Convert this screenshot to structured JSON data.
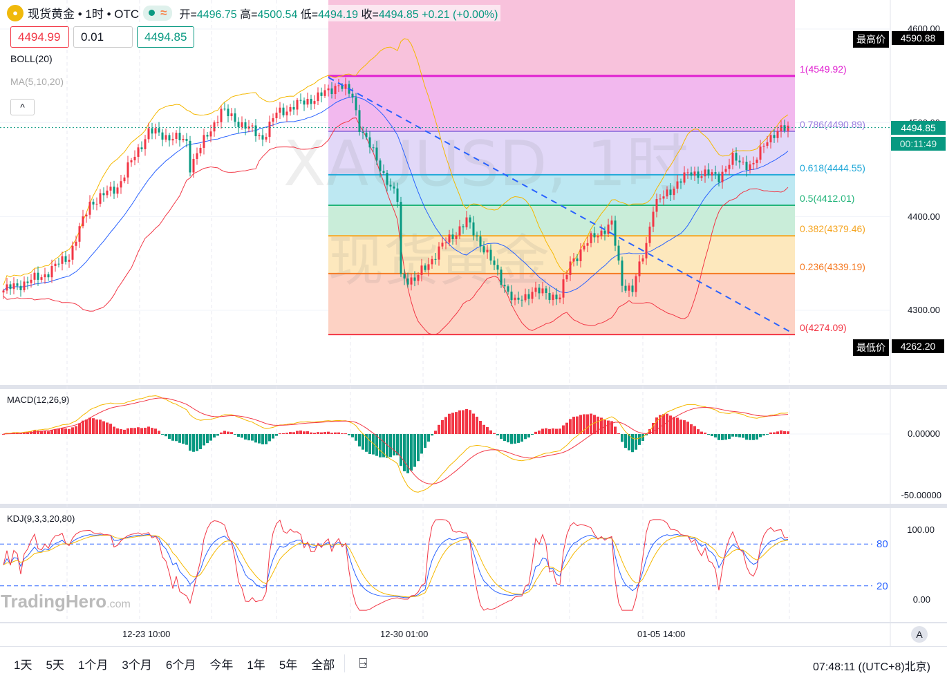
{
  "header": {
    "symbol": "现货黄金 • 1时 • OTC",
    "open_label": "开=",
    "open": "4496.75",
    "high_label": "高=",
    "high": "4500.54",
    "low_label": "低=",
    "low": "4494.19",
    "close_label": "收=",
    "close": "4494.85",
    "change": "+0.21 (+0.00%)"
  },
  "order": {
    "sell": "4494.99",
    "spread": "0.01",
    "buy": "4494.85"
  },
  "indicators": {
    "boll": "BOLL(20)",
    "ma": "MA(5,10,20)",
    "collapse": "^"
  },
  "price_axis": {
    "ticks": [
      "4600.00",
      "4500.00",
      "4400.00",
      "4300.00"
    ],
    "highest_label": "最高价",
    "highest": "4590.88",
    "lowest_label": "最低价",
    "lowest": "4262.20",
    "last": "4494.85",
    "countdown": "00:11:49"
  },
  "watermark": {
    "line1": "XAUUSD, 1时",
    "line2": "现货黄金",
    "brand": "TradingHero",
    "brand_suffix": ".com"
  },
  "fib": {
    "levels": [
      {
        "ratio": "1",
        "price": 4549.92,
        "color": "#e020d0"
      },
      {
        "ratio": "0.786",
        "price": 4490.89,
        "color": "#9c7fe0"
      },
      {
        "ratio": "0.618",
        "price": 4444.55,
        "color": "#21a8d8"
      },
      {
        "ratio": "0.5",
        "price": 4412.01,
        "color": "#22b47a"
      },
      {
        "ratio": "0.382",
        "price": 4379.46,
        "color": "#f5a623"
      },
      {
        "ratio": "0.236",
        "price": 4339.19,
        "color": "#f57a23"
      },
      {
        "ratio": "0",
        "price": 4274.09,
        "color": "#f23645"
      }
    ],
    "labels": [
      "1(4549.92)",
      "0.786(4490.89)",
      "0.618(4444.55)",
      "0.5(4412.01)",
      "0.382(4379.46)",
      "0.236(4339.19)",
      "0(4274.09)"
    ]
  },
  "macd": {
    "label": "MACD(12,26,9)",
    "ticks": [
      "0.00000",
      "-50.00000"
    ]
  },
  "kdj": {
    "label": "KDJ(9,3,3,20,80)",
    "ticks": [
      "100.00",
      "0.00"
    ],
    "levels": [
      "80",
      "20"
    ]
  },
  "time_axis": [
    "12-23 10:00",
    "12-30 01:00",
    "01-05 14:00"
  ],
  "auto_label": "A",
  "ranges": [
    "1天",
    "5天",
    "1个月",
    "3个月",
    "6个月",
    "今年",
    "1年",
    "5年",
    "全部"
  ],
  "clock": "07:48:11 ((UTC+8)北京)",
  "colors": {
    "up": "#f23645",
    "down": "#089981",
    "boll_upper": "#f5b800",
    "boll_mid": "#2962ff",
    "boll_lower": "#f23645"
  },
  "chart_data": {
    "type": "candlestick",
    "symbol": "XAUUSD",
    "interval": "1h",
    "ylim": [
      4262,
      4600
    ],
    "waypoints": [
      [
        0,
        4321
      ],
      [
        11,
        4336
      ],
      [
        19,
        4358
      ],
      [
        25,
        4414
      ],
      [
        33,
        4432
      ],
      [
        42,
        4491
      ],
      [
        53,
        4480
      ],
      [
        54,
        4454
      ],
      [
        63,
        4513
      ],
      [
        75,
        4484
      ],
      [
        79,
        4510
      ],
      [
        93,
        4531
      ],
      [
        97,
        4542
      ],
      [
        101,
        4527
      ],
      [
        103,
        4497
      ],
      [
        108,
        4460
      ],
      [
        114,
        4417
      ],
      [
        115,
        4336
      ],
      [
        119,
        4332
      ],
      [
        127,
        4369
      ],
      [
        134,
        4395
      ],
      [
        139,
        4366
      ],
      [
        148,
        4307
      ],
      [
        153,
        4321
      ],
      [
        161,
        4314
      ],
      [
        164,
        4351
      ],
      [
        171,
        4380
      ],
      [
        176,
        4391
      ],
      [
        179,
        4329
      ],
      [
        182,
        4321
      ],
      [
        186,
        4372
      ],
      [
        188,
        4410
      ],
      [
        195,
        4436
      ],
      [
        199,
        4447
      ],
      [
        207,
        4443
      ],
      [
        211,
        4461
      ],
      [
        217,
        4454
      ],
      [
        221,
        4484
      ],
      [
        227,
        4495
      ]
    ]
  }
}
